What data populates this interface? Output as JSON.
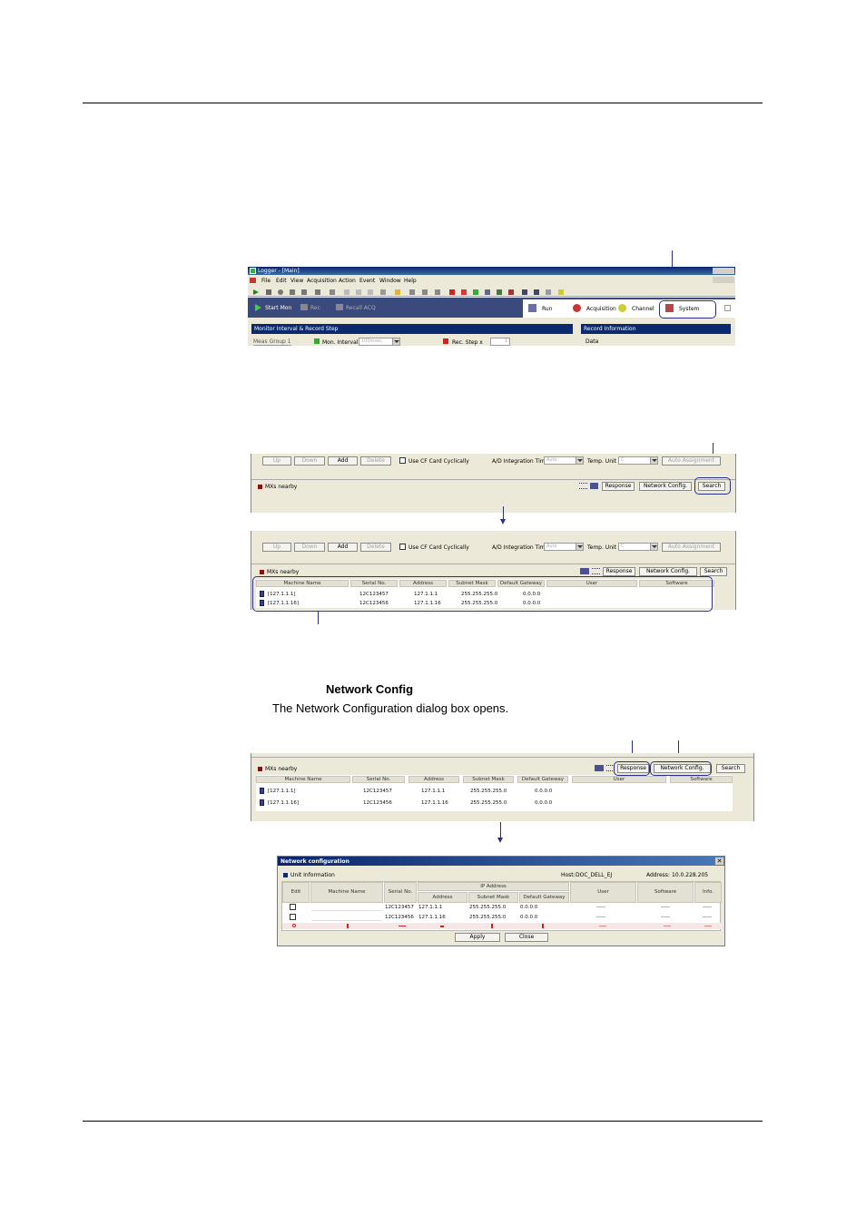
{
  "step1": {
    "window_title": "Logger - [Main]",
    "menu": [
      "File",
      "Edit",
      "View",
      "Acquisition",
      "Action",
      "Event",
      "Window",
      "Help"
    ],
    "start_mon": "Start Mon",
    "rec": "Rec",
    "recall_acq": "Recall ACQ",
    "tabs": [
      "Run",
      "Acquisition",
      "Channel",
      "System"
    ],
    "monitor_panel_title": "Monitor Interval & Record Step",
    "record_panel_title": "Record Information",
    "meas_group": "Meas Group 1",
    "mon_interval_label": "Mon. Interval",
    "mon_interval_value": "100msec",
    "rec_step_label": "Rec. Step x",
    "rec_step_value": "1",
    "data_label": "Data"
  },
  "controls": {
    "up": "Up",
    "down": "Down",
    "add": "Add",
    "delete": "Delete",
    "use_cf": "Use CF Card Cyclically",
    "ad_label": "A/D Integration Time",
    "ad_value": "Auto",
    "temp_label": "Temp. Unit",
    "temp_value": "C",
    "auto_assign": "Auto Assignment",
    "mxs_nearby": "MXs nearby",
    "response": "Response",
    "network_config": "Network Config.",
    "search": "Search"
  },
  "table": {
    "headers": [
      "Machine Name",
      "Serial No.",
      "Address",
      "Subnet Mask",
      "Default Gateway",
      "User",
      "Software"
    ],
    "rows": [
      {
        "name": "[127.1.1.1]",
        "serial": "12C123457",
        "address": "127.1.1.1",
        "mask": "255.255.255.0",
        "gateway": "0.0.0.0"
      },
      {
        "name": "[127.1.1.16]",
        "serial": "12C123456",
        "address": "127.1.1.16",
        "mask": "255.255.255.0",
        "gateway": "0.0.0.0"
      }
    ]
  },
  "step_text": {
    "heading": "Network Config",
    "body": "The Network Configuration dialog box opens."
  },
  "dialog": {
    "title": "Network configuration",
    "unit_info": "Unit Information",
    "host_label": "Host:",
    "host_value": "DOC_DELL_EJ",
    "address_label": "Address:",
    "address_value": "10.0.228.205",
    "headers": {
      "edit": "Edit",
      "machine_name": "Machine Name",
      "serial": "Serial No.",
      "ip_address": "IP Address",
      "address": "Address",
      "subnet": "Subnet Mask",
      "gateway": "Default Gateway",
      "user": "User",
      "software": "Software",
      "info": "Info."
    },
    "rows": [
      {
        "serial": "12C123457",
        "address": "127.1.1.1",
        "mask": "255.255.255.0",
        "gateway": "0.0.0.0",
        "user": "-----",
        "software": "-----",
        "info": "-----"
      },
      {
        "serial": "12C123456",
        "address": "127.1.1.16",
        "mask": "255.255.255.0",
        "gateway": "0.0.0.0",
        "user": "-----",
        "software": "-----",
        "info": "-----"
      }
    ],
    "apply": "Apply",
    "close": "Close"
  }
}
